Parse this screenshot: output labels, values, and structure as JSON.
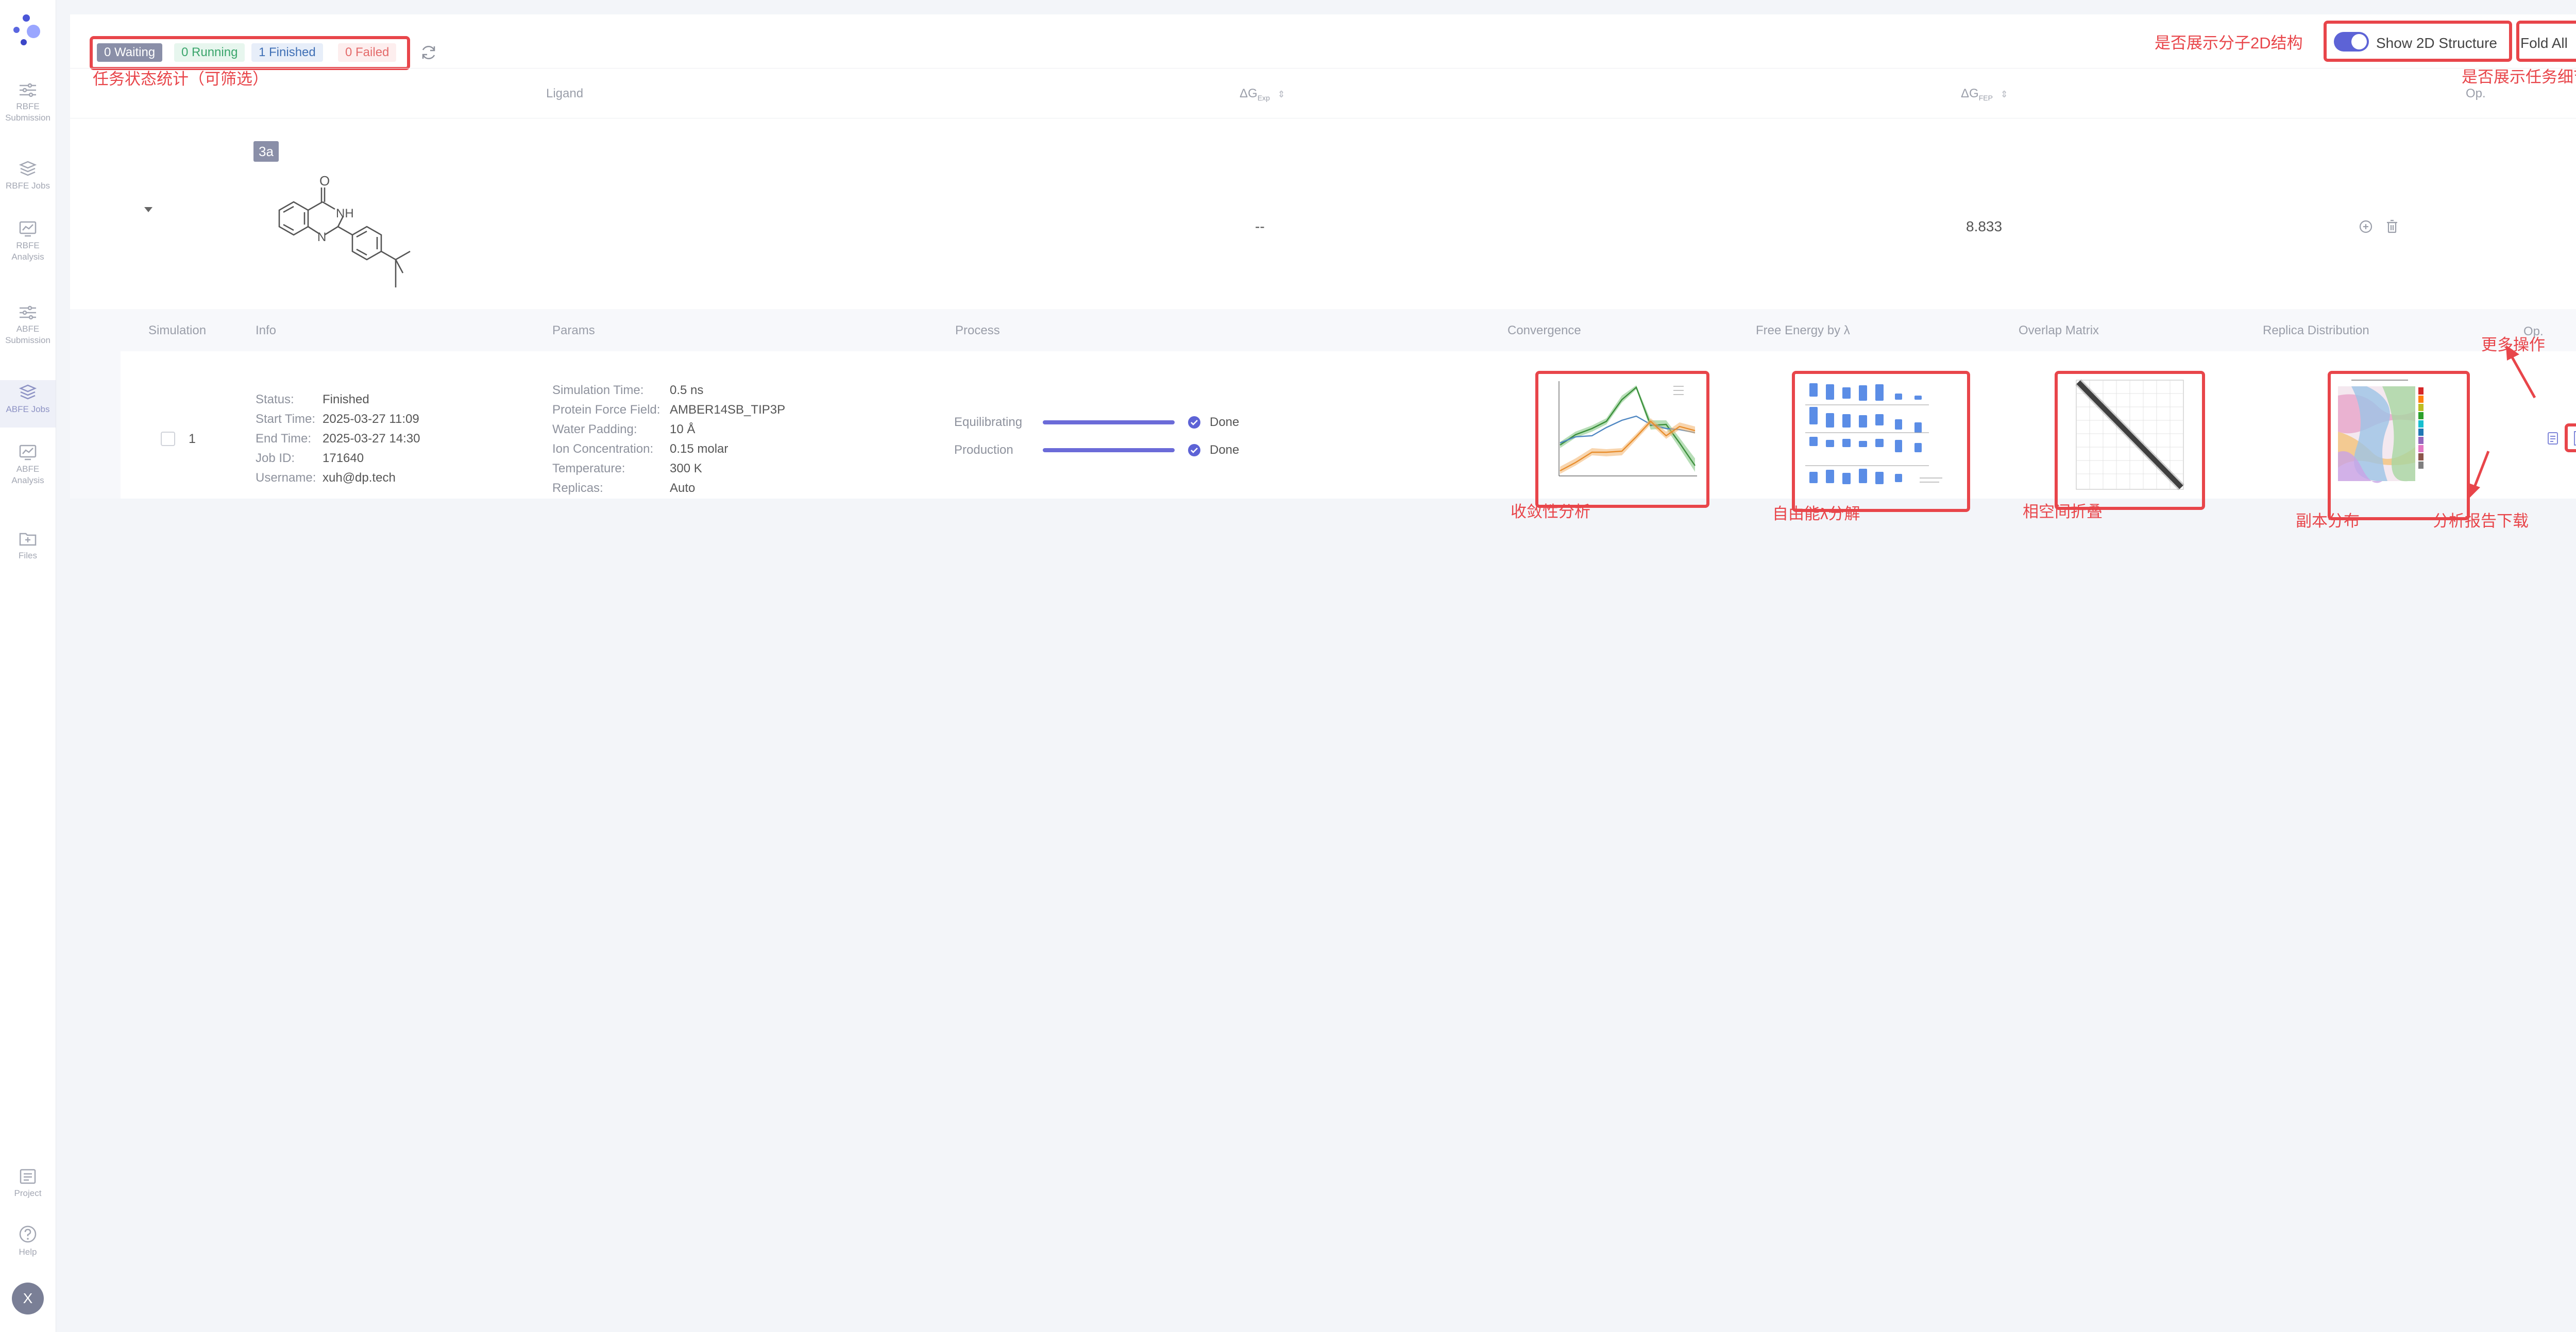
{
  "sidebar": {
    "items": [
      {
        "line1": "RBFE",
        "line2": "Submission"
      },
      {
        "line1": "RBFE Jobs",
        "line2": ""
      },
      {
        "line1": "RBFE",
        "line2": "Analysis"
      },
      {
        "line1": "ABFE",
        "line2": "Submission"
      },
      {
        "line1": "ABFE Jobs",
        "line2": ""
      },
      {
        "line1": "ABFE",
        "line2": "Analysis"
      },
      {
        "line1": "Files",
        "line2": ""
      },
      {
        "line1": "Project",
        "line2": ""
      },
      {
        "line1": "Help",
        "line2": ""
      }
    ],
    "active_index": 4,
    "avatar": "X"
  },
  "status": {
    "waiting": "0 Waiting",
    "running": "0 Running",
    "finished": "1 Finished",
    "failed": "0 Failed"
  },
  "toolbar": {
    "show_2d_label": "Show 2D Structure",
    "show_2d_enabled": true,
    "fold_label": "Fold All"
  },
  "annotations": {
    "status_stats": "任务状态统计（可筛选）",
    "show_2d": "是否展示分子2D结构",
    "fold_all": "是否展示任务细节",
    "more_ops": "更多操作",
    "convergence": "收敛性分析",
    "free_energy": "自由能λ分解",
    "overlap": "相空间折叠",
    "replica": "副本分布",
    "report": "分析报告下载"
  },
  "table": {
    "columns": {
      "ligand": "Ligand",
      "dg_exp": "ΔG",
      "dg_exp_sub": "Exp",
      "dg_fep": "ΔG",
      "dg_fep_sub": "FEP",
      "op": "Op."
    },
    "row": {
      "ligand_name": "3a",
      "dg_exp": "--",
      "dg_fep": "8.833",
      "atom_o": "O",
      "atom_nh": "NH",
      "atom_n": "N"
    }
  },
  "subtable": {
    "columns": {
      "simulation": "Simulation",
      "info": "Info",
      "params": "Params",
      "process": "Process",
      "convergence": "Convergence",
      "free_energy": "Free Energy by λ",
      "overlap": "Overlap Matrix",
      "replica": "Replica Distribution",
      "op": "Op."
    },
    "row": {
      "index": "1",
      "info": [
        {
          "label": "Status:",
          "value": "Finished"
        },
        {
          "label": "Start Time:",
          "value": "2025-03-27 11:09"
        },
        {
          "label": "End Time:",
          "value": "2025-03-27 14:30"
        },
        {
          "label": "Job ID:",
          "value": "171640"
        },
        {
          "label": "Username:",
          "value": "xuh@dp.tech"
        }
      ],
      "params": [
        {
          "label": "Simulation Time:",
          "value": "0.5 ns"
        },
        {
          "label": "Protein Force Field:",
          "value": "AMBER14SB_TIP3P"
        },
        {
          "label": "Water Padding:",
          "value": "10 Å"
        },
        {
          "label": "Ion Concentration:",
          "value": "0.15 molar"
        },
        {
          "label": "Temperature:",
          "value": "300 K"
        },
        {
          "label": "Replicas:",
          "value": "Auto"
        }
      ],
      "process": [
        {
          "label": "Equilibrating",
          "status": "Done",
          "progress": 1.0
        },
        {
          "label": "Production",
          "status": "Done",
          "progress": 1.0
        }
      ]
    }
  },
  "colors": {
    "accent": "#5d63d6",
    "annotation_red": "#e8454a",
    "waiting_bg": "#8a8fa8",
    "running_text": "#3aa56b",
    "finished_text": "#3f6fb5",
    "failed_text": "#e46a6a"
  }
}
